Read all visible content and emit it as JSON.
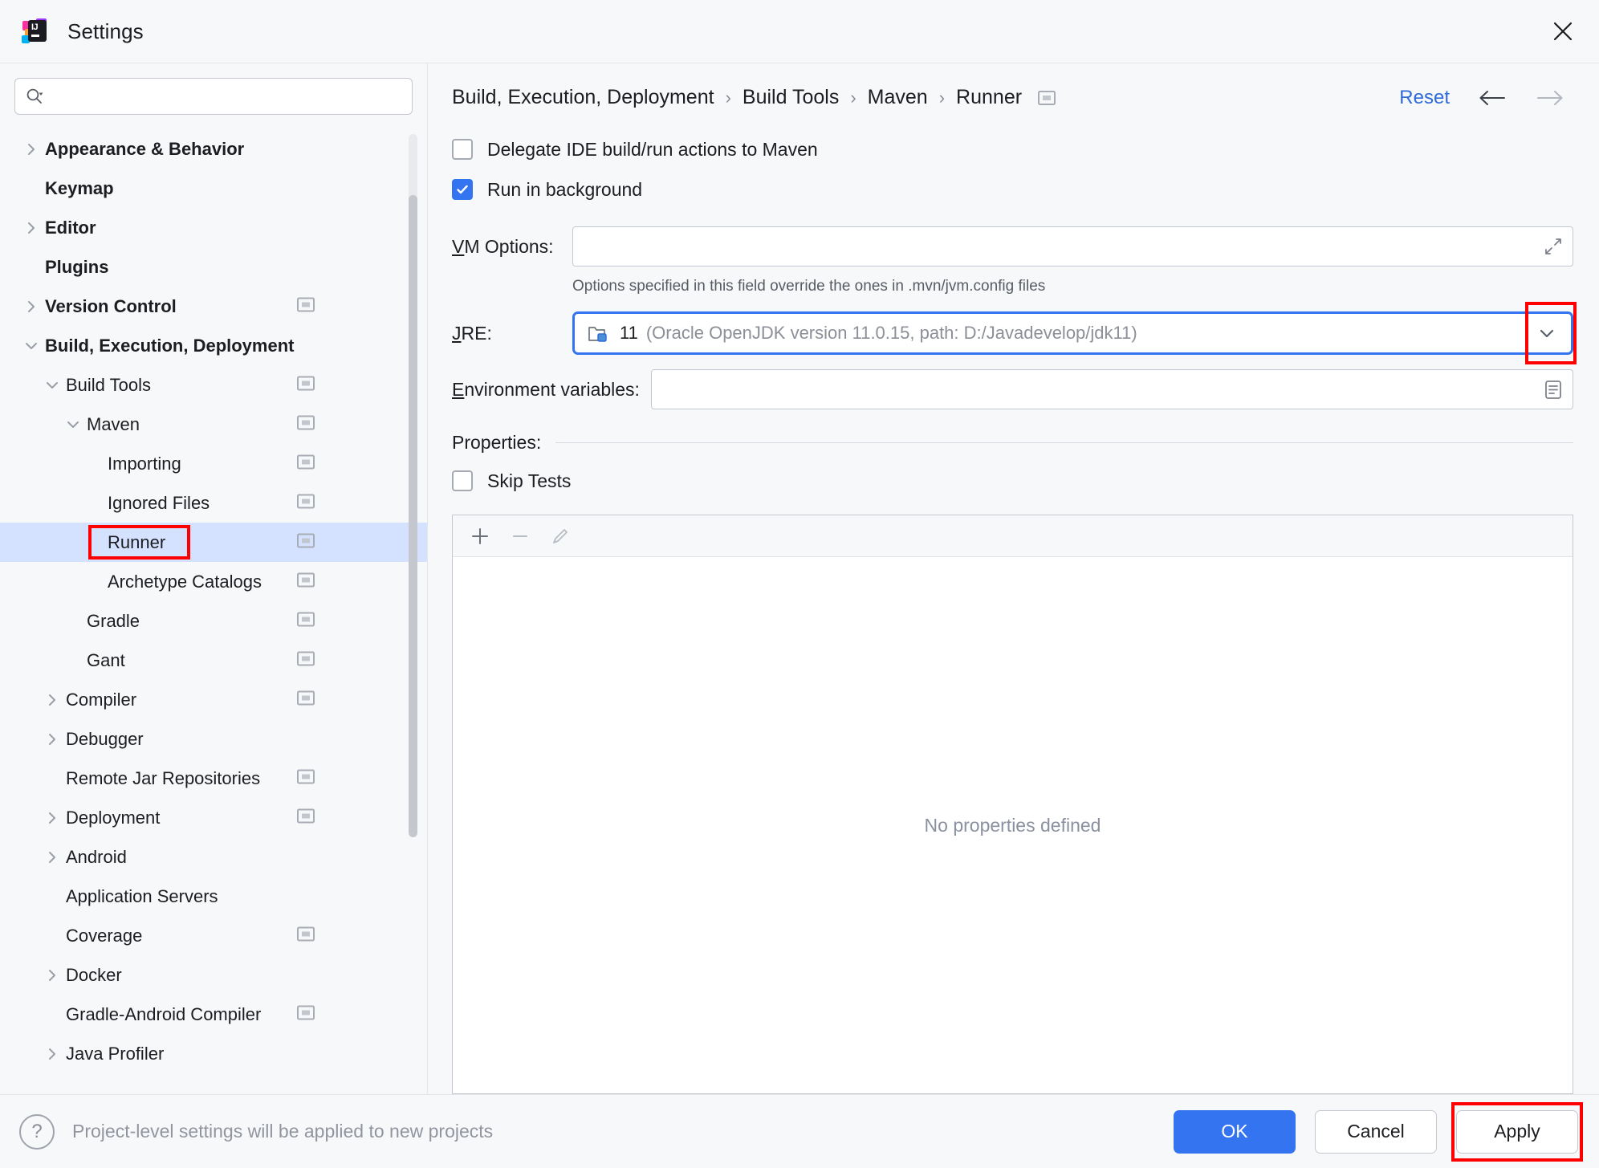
{
  "window": {
    "title": "Settings",
    "app_icon": "intellij-idea-icon",
    "close_icon": "close-icon"
  },
  "search": {
    "placeholder": "",
    "value": "",
    "icon": "search-icon"
  },
  "sidebar": {
    "items": [
      {
        "label": "Appearance & Behavior",
        "level": 0,
        "arrow": "chevron-right",
        "badge": false,
        "selected": false
      },
      {
        "label": "Keymap",
        "level": 0,
        "arrow": "none",
        "badge": false,
        "selected": false
      },
      {
        "label": "Editor",
        "level": 0,
        "arrow": "chevron-right",
        "badge": false,
        "selected": false
      },
      {
        "label": "Plugins",
        "level": 0,
        "arrow": "none",
        "badge": false,
        "selected": false
      },
      {
        "label": "Version Control",
        "level": 0,
        "arrow": "chevron-right",
        "badge": true,
        "selected": false
      },
      {
        "label": "Build, Execution, Deployment",
        "level": 0,
        "arrow": "chevron-down",
        "badge": false,
        "selected": false
      },
      {
        "label": "Build Tools",
        "level": 1,
        "arrow": "chevron-down",
        "badge": true,
        "selected": false
      },
      {
        "label": "Maven",
        "level": 2,
        "arrow": "chevron-down",
        "badge": true,
        "selected": false
      },
      {
        "label": "Importing",
        "level": 3,
        "arrow": "none",
        "badge": true,
        "selected": false
      },
      {
        "label": "Ignored Files",
        "level": 3,
        "arrow": "none",
        "badge": true,
        "selected": false
      },
      {
        "label": "Runner",
        "level": 3,
        "arrow": "none",
        "badge": true,
        "selected": true
      },
      {
        "label": "Archetype Catalogs",
        "level": 3,
        "arrow": "none",
        "badge": true,
        "selected": false
      },
      {
        "label": "Gradle",
        "level": 2,
        "arrow": "none",
        "badge": true,
        "selected": false
      },
      {
        "label": "Gant",
        "level": 2,
        "arrow": "none",
        "badge": true,
        "selected": false
      },
      {
        "label": "Compiler",
        "level": 1,
        "arrow": "chevron-right",
        "badge": true,
        "selected": false
      },
      {
        "label": "Debugger",
        "level": 1,
        "arrow": "chevron-right",
        "badge": false,
        "selected": false
      },
      {
        "label": "Remote Jar Repositories",
        "level": 1,
        "arrow": "none",
        "badge": true,
        "selected": false
      },
      {
        "label": "Deployment",
        "level": 1,
        "arrow": "chevron-right",
        "badge": true,
        "selected": false
      },
      {
        "label": "Android",
        "level": 1,
        "arrow": "chevron-right",
        "badge": false,
        "selected": false
      },
      {
        "label": "Application Servers",
        "level": 1,
        "arrow": "none",
        "badge": false,
        "selected": false
      },
      {
        "label": "Coverage",
        "level": 1,
        "arrow": "none",
        "badge": true,
        "selected": false
      },
      {
        "label": "Docker",
        "level": 1,
        "arrow": "chevron-right",
        "badge": false,
        "selected": false
      },
      {
        "label": "Gradle-Android Compiler",
        "level": 1,
        "arrow": "none",
        "badge": true,
        "selected": false
      },
      {
        "label": "Java Profiler",
        "level": 1,
        "arrow": "chevron-right",
        "badge": false,
        "selected": false
      }
    ]
  },
  "breadcrumb": {
    "parts": [
      "Build, Execution, Deployment",
      "Build Tools",
      "Maven",
      "Runner"
    ],
    "separator": "›",
    "badge": "project-level-icon"
  },
  "header_actions": {
    "reset_label": "Reset",
    "back_icon": "arrow-left-icon",
    "forward_icon": "arrow-right-icon"
  },
  "main": {
    "delegate_checkbox": {
      "label": "Delegate IDE build/run actions to Maven",
      "checked": false
    },
    "background_checkbox": {
      "label": "Run in background",
      "checked": true
    },
    "vm_options": {
      "label": "VM Options:",
      "mnemonic": "V",
      "value": "",
      "expand_icon": "expand-icon"
    },
    "vm_hint": "Options specified in this field override the ones in .mvn/jvm.config files",
    "jre": {
      "label": "JRE:",
      "mnemonic": "J",
      "value_primary": "11",
      "value_secondary": "(Oracle OpenJDK version 11.0.15, path: D:/Javadevelop/jdk11)",
      "folder_icon": "folder-icon",
      "dropdown_icon": "chevron-down-icon"
    },
    "env_vars": {
      "label": "Environment variables:",
      "mnemonic": "E",
      "value": "",
      "browse_icon": "list-icon"
    },
    "properties": {
      "title": "Properties:",
      "skip_tests": {
        "label": "Skip Tests",
        "checked": false
      },
      "toolbar": [
        {
          "name": "add-property-button",
          "icon": "plus-icon",
          "enabled": true
        },
        {
          "name": "remove-property-button",
          "icon": "minus-icon",
          "enabled": false
        },
        {
          "name": "edit-property-button",
          "icon": "pencil-icon",
          "enabled": false
        }
      ],
      "empty_text": "No properties defined"
    }
  },
  "footer": {
    "help_icon": "question-mark-icon",
    "hint": "Project-level settings will be applied to new projects",
    "ok_label": "OK",
    "cancel_label": "Cancel",
    "apply_label": "Apply"
  },
  "annotations": {
    "accent_color": "#3574f0",
    "highlight_color": "#ff0000",
    "selection_color": "#d4e2ff"
  }
}
